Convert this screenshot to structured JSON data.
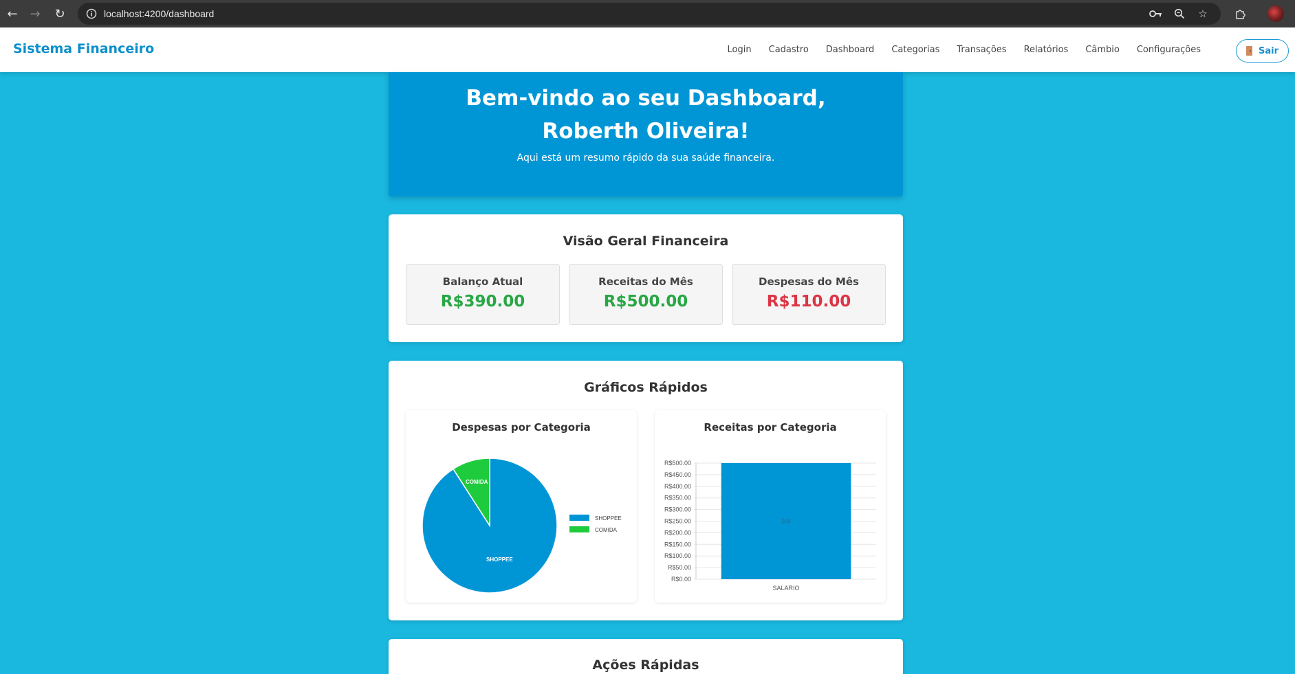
{
  "browser": {
    "url": "localhost:4200/dashboard",
    "icons": [
      "back-icon",
      "forward-icon",
      "reload-icon",
      "site-info-icon",
      "key-icon",
      "zoom-icon",
      "bookmark-star-icon",
      "extensions-icon",
      "profile-avatar"
    ]
  },
  "header": {
    "brand": "Sistema Financeiro",
    "nav": [
      "Login",
      "Cadastro",
      "Dashboard",
      "Categorias",
      "Transações",
      "Relatórios",
      "Câmbio",
      "Configurações"
    ],
    "logout_label": "Sair"
  },
  "hero": {
    "title": "Bem-vindo ao seu Dashboard, Roberth Oliveira!",
    "subtitle": "Aqui está um resumo rápido da sua saúde financeira."
  },
  "overview": {
    "title": "Visão Geral Financeira",
    "stats": [
      {
        "label": "Balanço Atual",
        "value": "R$390.00",
        "color": "#28a745"
      },
      {
        "label": "Receitas do Mês",
        "value": "R$500.00",
        "color": "#28a745"
      },
      {
        "label": "Despesas do Mês",
        "value": "R$110.00",
        "color": "#dc3545"
      }
    ]
  },
  "charts_section": {
    "title": "Gráficos Rápidos"
  },
  "actions": {
    "title": "Ações Rápidas"
  },
  "colors": {
    "primary": "#0096d6",
    "background": "#1ab7df",
    "pie_green": "#1ecb3c"
  },
  "chart_data": [
    {
      "type": "pie",
      "title": "Despesas por Categoria",
      "categories": [
        "SHOPPEE",
        "COMIDA"
      ],
      "values": [
        100,
        10
      ],
      "colors": [
        "#0096d6",
        "#1ecb3c"
      ],
      "legend": "right"
    },
    {
      "type": "bar",
      "title": "Receitas por Categoria",
      "categories": [
        "SALARIO"
      ],
      "values": [
        500
      ],
      "data_labels": [
        "500"
      ],
      "ylim": [
        0,
        500
      ],
      "yticks": [
        "R$0.00",
        "R$50.00",
        "R$100.00",
        "R$150.00",
        "R$200.00",
        "R$250.00",
        "R$300.00",
        "R$350.00",
        "R$400.00",
        "R$450.00",
        "R$500.00"
      ],
      "colors": [
        "#0096d6"
      ],
      "grid": true
    }
  ]
}
